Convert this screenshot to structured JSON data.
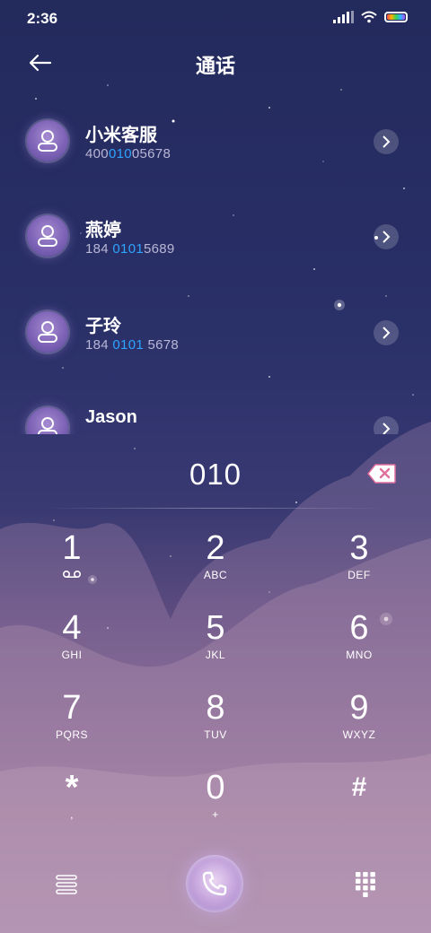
{
  "status_bar": {
    "time": "2:36"
  },
  "header": {
    "title": "通话"
  },
  "contacts": [
    {
      "name": "小米客服",
      "number_pre": "400",
      "number_hl": "010",
      "number_post": "05678"
    },
    {
      "name": "燕婷",
      "number_pre": "184 ",
      "number_hl": "0101",
      "number_post": "5689"
    },
    {
      "name": "子玲",
      "number_pre": "184 ",
      "number_hl": "0101",
      "number_post": " 5678"
    },
    {
      "name": "Jason",
      "number_pre": "",
      "number_hl": "",
      "number_post": ""
    }
  ],
  "dial": {
    "input": "010"
  },
  "keys": [
    {
      "digit": "1",
      "letters": ""
    },
    {
      "digit": "2",
      "letters": "ABC"
    },
    {
      "digit": "3",
      "letters": "DEF"
    },
    {
      "digit": "4",
      "letters": "GHI"
    },
    {
      "digit": "5",
      "letters": "JKL"
    },
    {
      "digit": "6",
      "letters": "MNO"
    },
    {
      "digit": "7",
      "letters": "PQRS"
    },
    {
      "digit": "8",
      "letters": "TUV"
    },
    {
      "digit": "9",
      "letters": "WXYZ"
    },
    {
      "digit": "*",
      "letters": ","
    },
    {
      "digit": "0",
      "letters": "+"
    },
    {
      "digit": "#",
      "letters": ""
    }
  ],
  "icons": {
    "back": "back-arrow-icon",
    "voicemail": "voicemail-icon",
    "backspace": "backspace-icon",
    "menu": "menu-icon",
    "call": "phone-icon",
    "dialpad": "dialpad-icon"
  },
  "colors": {
    "highlight": "#2ea3ff",
    "call_button": "#c8a7de"
  }
}
